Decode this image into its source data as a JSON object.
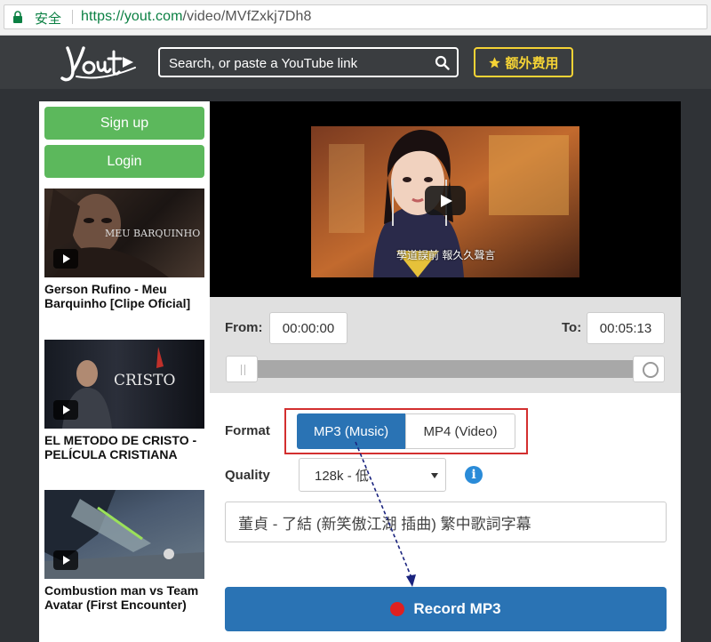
{
  "browser": {
    "secure_label": "安全",
    "url_host": "https://yout.com",
    "url_path": "/video/MVfZxkj7Dh8"
  },
  "header": {
    "logo_icon": "yout-logo-icon",
    "search_placeholder": "Search, or paste a YouTube link",
    "premium_label": "额外费用"
  },
  "sidebar": {
    "signup_label": "Sign up",
    "login_label": "Login",
    "videos": [
      {
        "title": "Gerson Rufino - Meu Barquinho [Clipe Oficial]",
        "thumb_text": "MEU BARQUINHO"
      },
      {
        "title": "EL METODO DE CRISTO - PELÍCULA CRISTIANA",
        "thumb_text": "CRISTO"
      },
      {
        "title": "Combustion man vs Team Avatar (First Encounter)",
        "thumb_text": ""
      }
    ]
  },
  "player": {
    "subtitle": "學道誤前 報久久聲言"
  },
  "trim": {
    "from_label": "From:",
    "from_value": "00:00:00",
    "to_label": "To:",
    "to_value": "00:05:13"
  },
  "options": {
    "format_label": "Format",
    "format_mp3": "MP3 (Music)",
    "format_mp4": "MP4 (Video)",
    "selected_format": "MP3 (Music)",
    "quality_label": "Quality",
    "quality_value": "128k - 低",
    "title_value": "董貞 - 了結 (新笑傲江湖 插曲) 繁中歌詞字幕",
    "record_label": "Record MP3"
  },
  "colors": {
    "header_bg": "#3a3d40",
    "green": "#5cb85c",
    "primary_blue": "#2a73b4",
    "premium_yellow": "#f5d335",
    "highlight_red": "#d32f2f"
  }
}
